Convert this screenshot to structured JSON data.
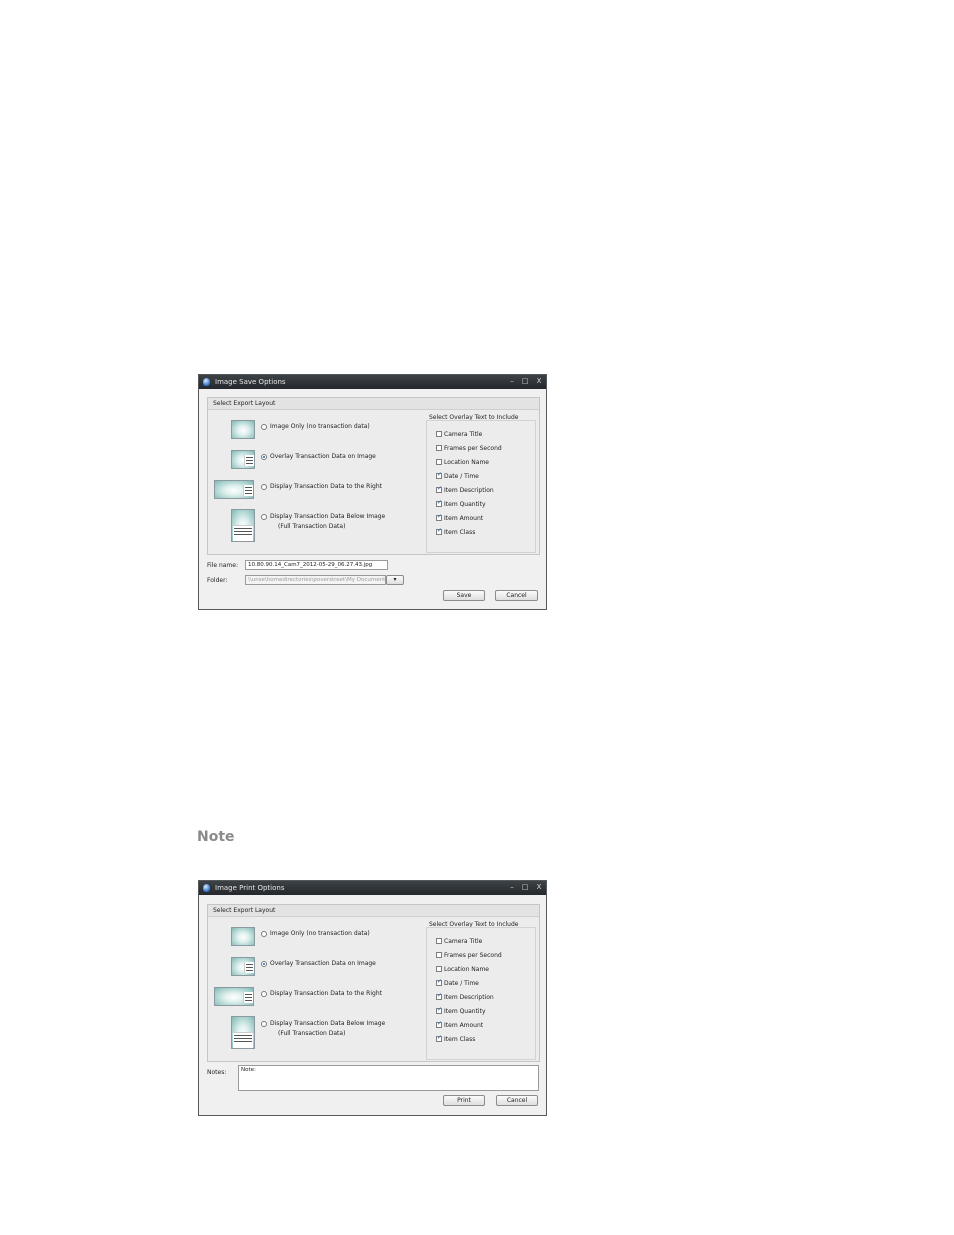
{
  "save_dialog": {
    "title": "Image Save Options",
    "min": "–",
    "max": "□",
    "close": "X",
    "group_title": "Select Export Layout",
    "layouts": [
      {
        "label": "Image Only (no transaction data)",
        "selected": false
      },
      {
        "label": "Overlay Transaction Data on Image",
        "selected": true
      },
      {
        "label": "Display Transaction Data to the Right",
        "selected": false
      },
      {
        "label": "Display Transaction Data Below Image",
        "label2": "(Full Transaction Data)",
        "selected": false
      }
    ],
    "overlay_title": "Select Overlay Text to Include",
    "overlay_items": [
      {
        "label": "Camera Title",
        "checked": false
      },
      {
        "label": "Frames per Second",
        "checked": false
      },
      {
        "label": "Location Name",
        "checked": false
      },
      {
        "label": "Date / Time",
        "checked": true
      },
      {
        "label": "Item Description",
        "checked": true
      },
      {
        "label": "Item Quantity",
        "checked": true
      },
      {
        "label": "Item Amount",
        "checked": true
      },
      {
        "label": "Item Class",
        "checked": true
      }
    ],
    "file_name_label": "File name:",
    "file_name_value": "10.80.90.14_Cam7_2012-05-29_06.27.43.jpg",
    "folder_label": "Folder:",
    "folder_value": "\\\\unse\\homedirectories\\poverstreet\\My Documents",
    "browse_label": "▾",
    "save_button": "Save",
    "cancel_button": "Cancel"
  },
  "note_heading": "Note",
  "print_dialog": {
    "title": "Image Print Options",
    "min": "–",
    "max": "□",
    "close": "X",
    "group_title": "Select Export Layout",
    "layouts": [
      {
        "label": "Image Only (no transaction data)",
        "selected": false
      },
      {
        "label": "Overlay Transaction Data on Image",
        "selected": true
      },
      {
        "label": "Display Transaction Data to the Right",
        "selected": false
      },
      {
        "label": "Display Transaction Data Below Image",
        "label2": "(Full Transaction Data)",
        "selected": false
      }
    ],
    "overlay_title": "Select Overlay Text to Include",
    "overlay_items": [
      {
        "label": "Camera Title",
        "checked": false
      },
      {
        "label": "Frames per Second",
        "checked": false
      },
      {
        "label": "Location Name",
        "checked": false
      },
      {
        "label": "Date / Time",
        "checked": true
      },
      {
        "label": "Item Description",
        "checked": true
      },
      {
        "label": "Item Quantity",
        "checked": true
      },
      {
        "label": "Item Amount",
        "checked": true
      },
      {
        "label": "Item Class",
        "checked": true
      }
    ],
    "notes_label": "Notes:",
    "notes_value": "Note:",
    "print_button": "Print",
    "cancel_button": "Cancel"
  }
}
